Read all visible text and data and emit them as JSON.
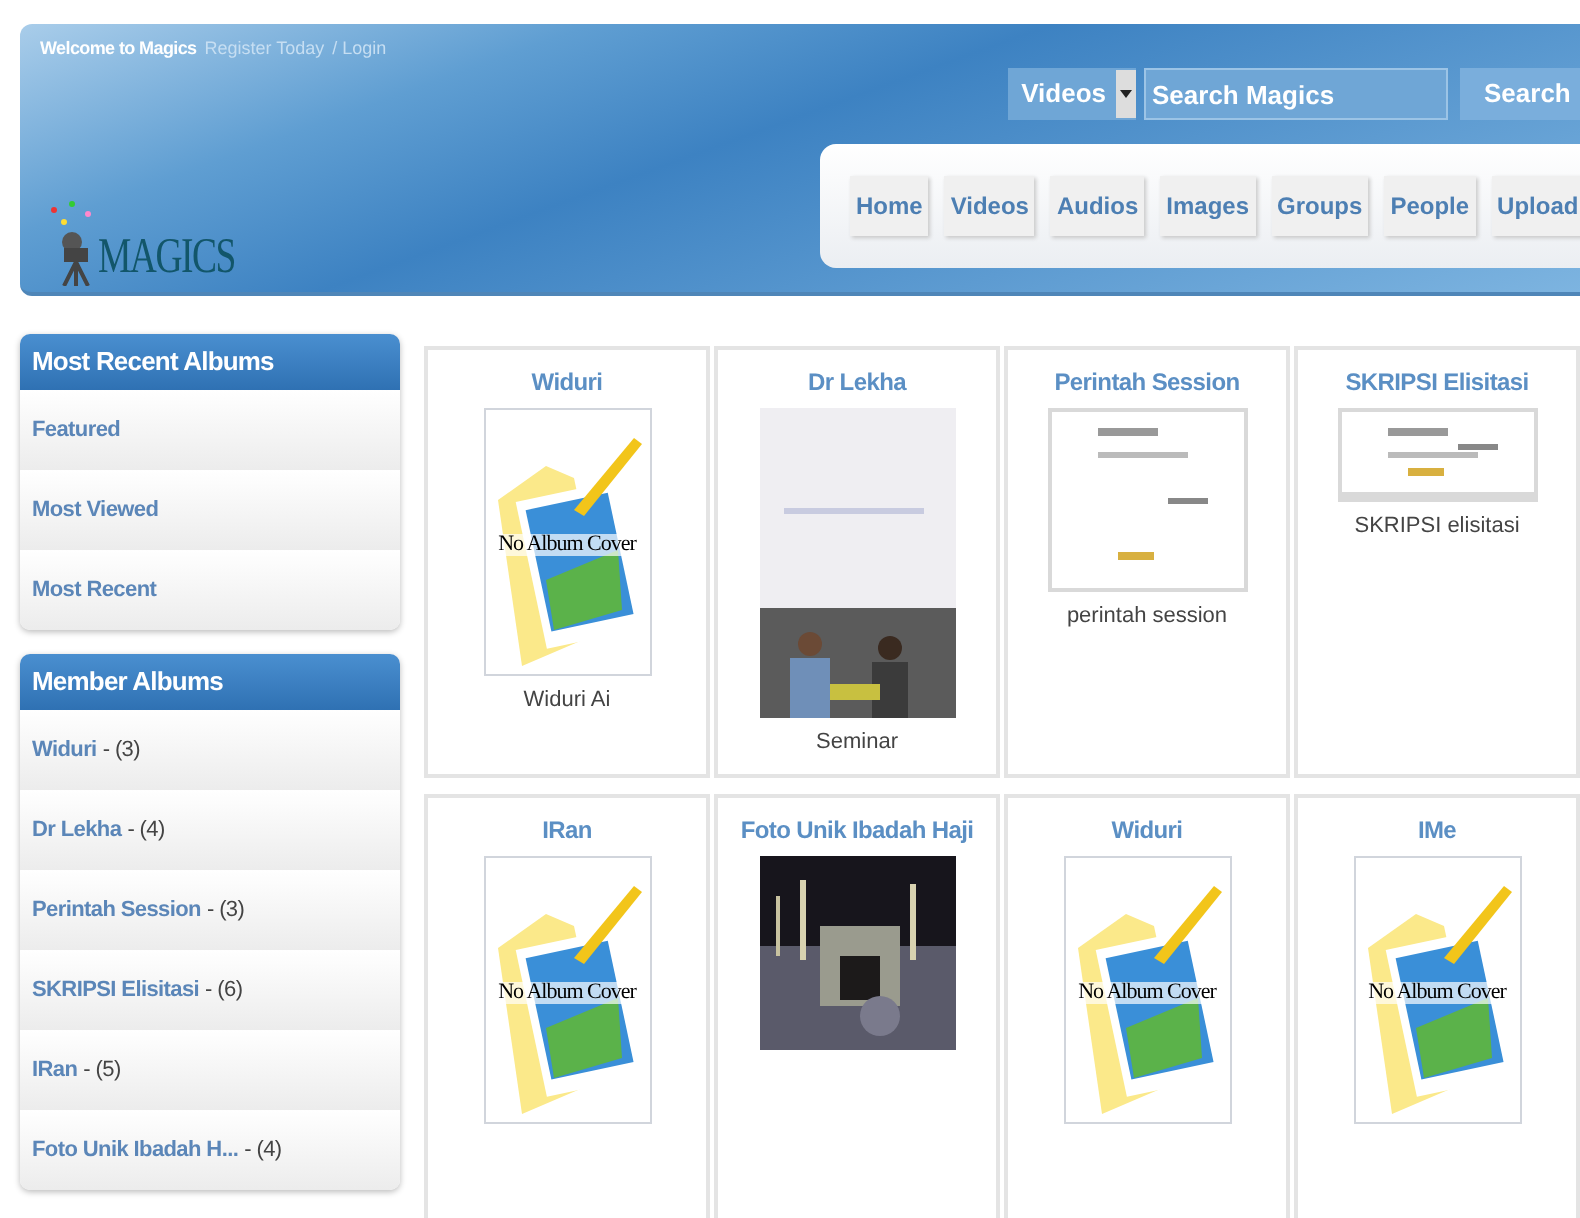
{
  "header": {
    "welcome": "Welcome to Magics",
    "register_link": "Register Today",
    "login_link": "/ Login",
    "search": {
      "category": "Videos",
      "placeholder": "Search Magics",
      "button": "Search"
    },
    "logo": "MAGICS",
    "nav": [
      {
        "label": "Home"
      },
      {
        "label": "Videos"
      },
      {
        "label": "Audios"
      },
      {
        "label": "Images"
      },
      {
        "label": "Groups"
      },
      {
        "label": "People"
      },
      {
        "label": "Upload"
      }
    ]
  },
  "sidebar": [
    {
      "title": "Most Recent Albums",
      "items": [
        {
          "label": "Featured"
        },
        {
          "label": "Most Viewed"
        },
        {
          "label": "Most Recent"
        }
      ]
    },
    {
      "title": "Member Albums",
      "items": [
        {
          "label": "Widuri",
          "count": "- (3)"
        },
        {
          "label": "Dr Lekha",
          "count": "- (4)"
        },
        {
          "label": "Perintah Session",
          "count": "- (3)"
        },
        {
          "label": "SKRIPSI Elisitasi",
          "count": "- (6)"
        },
        {
          "label": "IRan",
          "count": "- (5)"
        },
        {
          "label": "Foto Unik Ibadah H...",
          "count": "- (4)"
        }
      ]
    }
  ],
  "albums": [
    {
      "title": "Widuri",
      "cover": {
        "kind": "placeholder",
        "text": "No Album Cover"
      },
      "caption": "Widuri Ai"
    },
    {
      "title": "Dr Lekha",
      "caption": "Seminar"
    },
    {
      "title": "Perintah Session",
      "cover": {
        "kind": "screenshot"
      },
      "caption": "perintah session"
    },
    {
      "title": "SKRIPSI Elisitasi",
      "cover": {
        "kind": "screenshot"
      },
      "caption": "SKRIPSI elisitasi"
    },
    {
      "title": "IRan",
      "cover": {
        "kind": "placeholder",
        "text": "No Album Cover"
      }
    },
    {
      "title": "Foto Unik Ibadah Haji",
      "cover": {
        "kind": "night"
      }
    },
    {
      "title": "Widuri",
      "cover": {
        "kind": "placeholder",
        "text": "No Album Cover"
      }
    },
    {
      "title": "IMe",
      "cover": {
        "kind": "placeholder",
        "text": "No Album Cover"
      }
    }
  ]
}
